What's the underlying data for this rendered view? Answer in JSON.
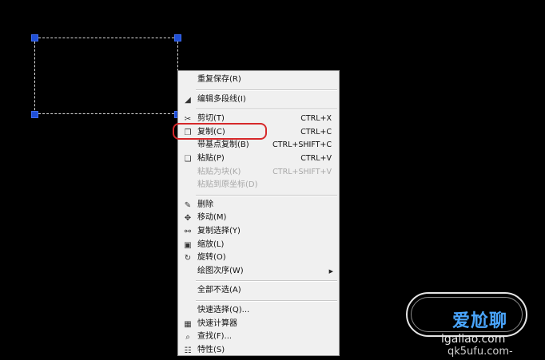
{
  "menu": {
    "items": [
      {
        "label": "重复保存(R)",
        "shortcut": "",
        "icon": "",
        "disabled": false
      },
      {
        "sep": true
      },
      {
        "label": "编辑多段线(I)",
        "shortcut": "",
        "icon": "polyline-edit-icon",
        "disabled": false
      },
      {
        "sep": true
      },
      {
        "label": "剪切(T)",
        "shortcut": "CTRL+X",
        "icon": "scissors-icon",
        "disabled": false
      },
      {
        "label": "复制(C)",
        "shortcut": "CTRL+C",
        "icon": "copy-icon",
        "disabled": false
      },
      {
        "label": "带基点复制(B)",
        "shortcut": "CTRL+SHIFT+C",
        "icon": "",
        "disabled": false
      },
      {
        "label": "粘贴(P)",
        "shortcut": "CTRL+V",
        "icon": "paste-icon",
        "disabled": false
      },
      {
        "label": "粘贴为块(K)",
        "shortcut": "CTRL+SHIFT+V",
        "icon": "",
        "disabled": true
      },
      {
        "label": "粘贴到原坐标(D)",
        "shortcut": "",
        "icon": "",
        "disabled": true
      },
      {
        "sep": true
      },
      {
        "label": "删除",
        "shortcut": "",
        "icon": "eraser-icon",
        "disabled": false
      },
      {
        "label": "移动(M)",
        "shortcut": "",
        "icon": "move-icon",
        "disabled": false
      },
      {
        "label": "复制选择(Y)",
        "shortcut": "",
        "icon": "copy-selection-icon",
        "disabled": false
      },
      {
        "label": "缩放(L)",
        "shortcut": "",
        "icon": "scale-icon",
        "disabled": false
      },
      {
        "label": "旋转(O)",
        "shortcut": "",
        "icon": "rotate-icon",
        "disabled": false
      },
      {
        "label": "绘图次序(W)",
        "shortcut": "",
        "icon": "",
        "disabled": false,
        "submenu": true
      },
      {
        "sep": true
      },
      {
        "label": "全部不选(A)",
        "shortcut": "",
        "icon": "",
        "disabled": false
      },
      {
        "sep": true
      },
      {
        "label": "快速选择(Q)...",
        "shortcut": "",
        "icon": "",
        "disabled": false
      },
      {
        "label": "快速计算器",
        "shortcut": "",
        "icon": "calculator-icon",
        "disabled": false
      },
      {
        "label": "查找(F)...",
        "shortcut": "",
        "icon": "find-icon",
        "disabled": false
      },
      {
        "label": "特性(S)",
        "shortcut": "",
        "icon": "properties-icon",
        "disabled": false
      }
    ]
  },
  "watermark": {
    "brand": "爱尬聊",
    "url": "igaliao.com",
    "url2": "qk5ufu.com-"
  },
  "colors": {
    "grip": "#1f4fd6",
    "highlight_ring": "#d6282a"
  }
}
